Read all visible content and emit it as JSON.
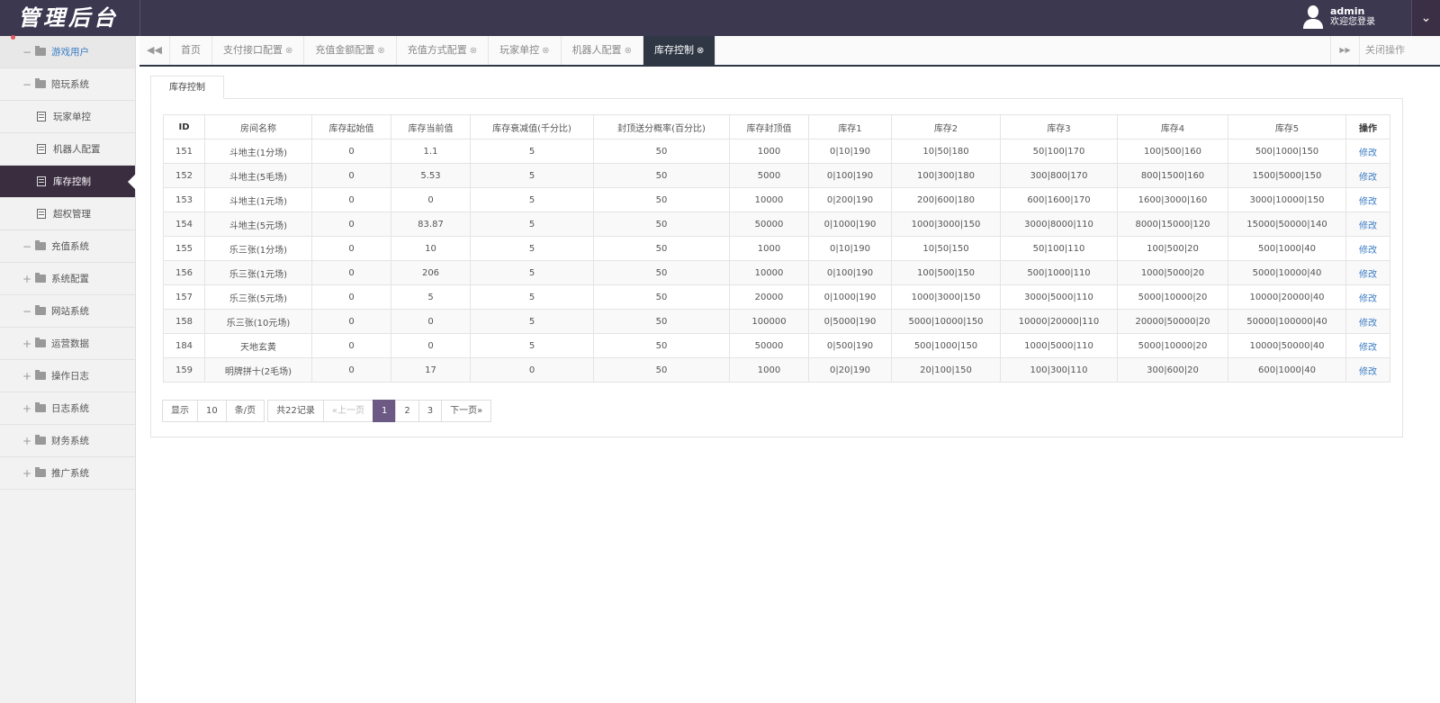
{
  "header": {
    "logo": "管理后台",
    "username": "admin",
    "welcome": "欢迎您登录"
  },
  "sidebar": {
    "items": [
      {
        "label": "游戏用户",
        "toggle": "−",
        "type": "group"
      },
      {
        "label": "陪玩系统",
        "toggle": "−",
        "type": "group"
      },
      {
        "label": "玩家单控",
        "type": "sub"
      },
      {
        "label": "机器人配置",
        "type": "sub"
      },
      {
        "label": "库存控制",
        "type": "sub",
        "active": true
      },
      {
        "label": "超权管理",
        "type": "sub"
      },
      {
        "label": "充值系统",
        "toggle": "−",
        "type": "group"
      },
      {
        "label": "系统配置",
        "toggle": "+",
        "type": "group"
      },
      {
        "label": "网站系统",
        "toggle": "−",
        "type": "group"
      },
      {
        "label": "运营数据",
        "toggle": "+",
        "type": "group"
      },
      {
        "label": "操作日志",
        "toggle": "+",
        "type": "group"
      },
      {
        "label": "日志系统",
        "toggle": "+",
        "type": "group"
      },
      {
        "label": "财务系统",
        "toggle": "+",
        "type": "group"
      },
      {
        "label": "推广系统",
        "toggle": "+",
        "type": "group"
      }
    ]
  },
  "tabs": {
    "items": [
      {
        "label": "首页",
        "closable": false
      },
      {
        "label": "支付接口配置",
        "closable": true
      },
      {
        "label": "充值金额配置",
        "closable": true
      },
      {
        "label": "充值方式配置",
        "closable": true
      },
      {
        "label": "玩家单控",
        "closable": true
      },
      {
        "label": "机器人配置",
        "closable": true
      },
      {
        "label": "库存控制",
        "closable": true,
        "active": true
      }
    ],
    "close_ops": "关闭操作"
  },
  "panel": {
    "tab": "库存控制"
  },
  "table": {
    "headers": [
      "ID",
      "房间名称",
      "库存起始值",
      "库存当前值",
      "库存衰减值(千分比)",
      "封顶送分概率(百分比)",
      "库存封顶值",
      "库存1",
      "库存2",
      "库存3",
      "库存4",
      "库存5",
      "操作"
    ],
    "action_label": "修改",
    "rows": [
      [
        "151",
        "斗地主(1分场)",
        "0",
        "1.1",
        "5",
        "50",
        "1000",
        "0|10|190",
        "10|50|180",
        "50|100|170",
        "100|500|160",
        "500|1000|150"
      ],
      [
        "152",
        "斗地主(5毛场)",
        "0",
        "5.53",
        "5",
        "50",
        "5000",
        "0|100|190",
        "100|300|180",
        "300|800|170",
        "800|1500|160",
        "1500|5000|150"
      ],
      [
        "153",
        "斗地主(1元场)",
        "0",
        "0",
        "5",
        "50",
        "10000",
        "0|200|190",
        "200|600|180",
        "600|1600|170",
        "1600|3000|160",
        "3000|10000|150"
      ],
      [
        "154",
        "斗地主(5元场)",
        "0",
        "83.87",
        "5",
        "50",
        "50000",
        "0|1000|190",
        "1000|3000|150",
        "3000|8000|110",
        "8000|15000|120",
        "15000|50000|140"
      ],
      [
        "155",
        "乐三张(1分场)",
        "0",
        "10",
        "5",
        "50",
        "1000",
        "0|10|190",
        "10|50|150",
        "50|100|110",
        "100|500|20",
        "500|1000|40"
      ],
      [
        "156",
        "乐三张(1元场)",
        "0",
        "206",
        "5",
        "50",
        "10000",
        "0|100|190",
        "100|500|150",
        "500|1000|110",
        "1000|5000|20",
        "5000|10000|40"
      ],
      [
        "157",
        "乐三张(5元场)",
        "0",
        "5",
        "5",
        "50",
        "20000",
        "0|1000|190",
        "1000|3000|150",
        "3000|5000|110",
        "5000|10000|20",
        "10000|20000|40"
      ],
      [
        "158",
        "乐三张(10元场)",
        "0",
        "0",
        "5",
        "50",
        "100000",
        "0|5000|190",
        "5000|10000|150",
        "10000|20000|110",
        "20000|50000|20",
        "50000|100000|40"
      ],
      [
        "184",
        "天地玄黄",
        "0",
        "0",
        "5",
        "50",
        "50000",
        "0|500|190",
        "500|1000|150",
        "1000|5000|110",
        "5000|10000|20",
        "10000|50000|40"
      ],
      [
        "159",
        "明牌拼十(2毛场)",
        "0",
        "17",
        "0",
        "50",
        "1000",
        "0|20|190",
        "20|100|150",
        "100|300|110",
        "300|600|20",
        "600|1000|40"
      ]
    ]
  },
  "pagination": {
    "show": "显示",
    "page_size": "10",
    "per_page": "条/页",
    "total": "共22记录",
    "prev": "«上一页",
    "pages": [
      "1",
      "2",
      "3"
    ],
    "current": "1",
    "next": "下一页»"
  }
}
